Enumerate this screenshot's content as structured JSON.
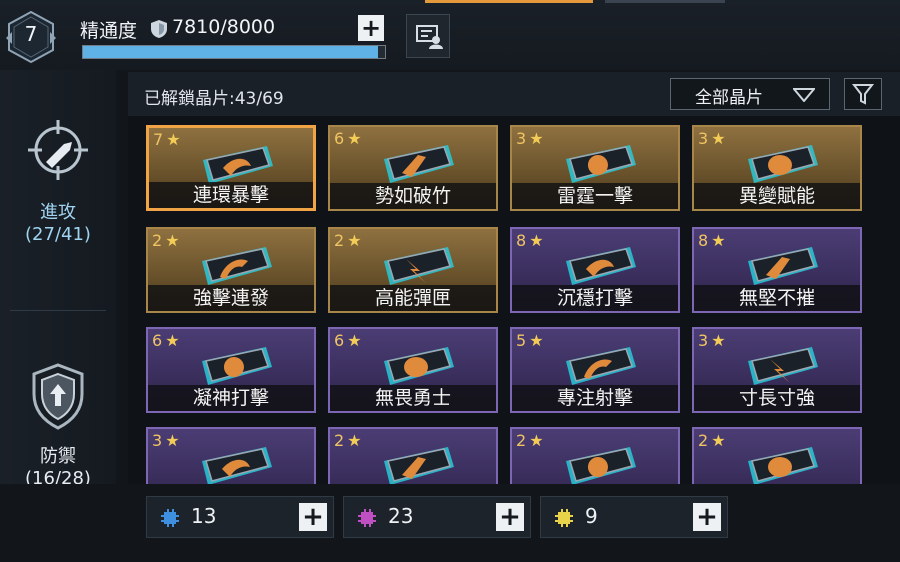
{
  "header": {
    "level": "7",
    "mastery_label": "精通度",
    "mastery_value": "7810/8000",
    "mastery_progress": 0.976,
    "plus_label": "+",
    "info_icon": "briefing-icon"
  },
  "sidebar": {
    "attack": {
      "label": "進攻",
      "count": "(27/41)",
      "icon": "crosshair-bullet-icon"
    },
    "defense": {
      "label": "防禦",
      "count": "(16/28)",
      "icon": "shield-arrow-icon"
    }
  },
  "toolbar": {
    "unlocked": "已解鎖晶片:43/69",
    "filter_dropdown": "全部晶片",
    "filter_icon": "funnel-icon"
  },
  "cards": [
    {
      "stars": "7",
      "name": "連環暴擊",
      "rarity": "gold",
      "selected": true
    },
    {
      "stars": "6",
      "name": "勢如破竹",
      "rarity": "gold"
    },
    {
      "stars": "3",
      "name": "雷霆一擊",
      "rarity": "gold"
    },
    {
      "stars": "3",
      "name": "異變賦能",
      "rarity": "gold"
    },
    {
      "stars": "2",
      "name": "強擊連發",
      "rarity": "gold"
    },
    {
      "stars": "2",
      "name": "高能彈匣",
      "rarity": "gold"
    },
    {
      "stars": "8",
      "name": "沉穩打擊",
      "rarity": "purple"
    },
    {
      "stars": "8",
      "name": "無堅不摧",
      "rarity": "purple"
    },
    {
      "stars": "6",
      "name": "凝神打擊",
      "rarity": "purple"
    },
    {
      "stars": "6",
      "name": "無畏勇士",
      "rarity": "purple"
    },
    {
      "stars": "5",
      "name": "專注射擊",
      "rarity": "purple"
    },
    {
      "stars": "3",
      "name": "寸長寸強",
      "rarity": "purple"
    },
    {
      "stars": "3",
      "name": "",
      "rarity": "purple"
    },
    {
      "stars": "2",
      "name": "",
      "rarity": "purple"
    },
    {
      "stars": "2",
      "name": "",
      "rarity": "purple"
    },
    {
      "stars": "2",
      "name": "",
      "rarity": "purple"
    }
  ],
  "resources": [
    {
      "count": "13",
      "color": "#3f8fe0",
      "icon": "chip-blue-icon"
    },
    {
      "count": "23",
      "color": "#c04fc2",
      "icon": "chip-purple-icon"
    },
    {
      "count": "9",
      "color": "#e8d24a",
      "icon": "chip-gold-icon"
    }
  ],
  "resource_plus_label": "+"
}
